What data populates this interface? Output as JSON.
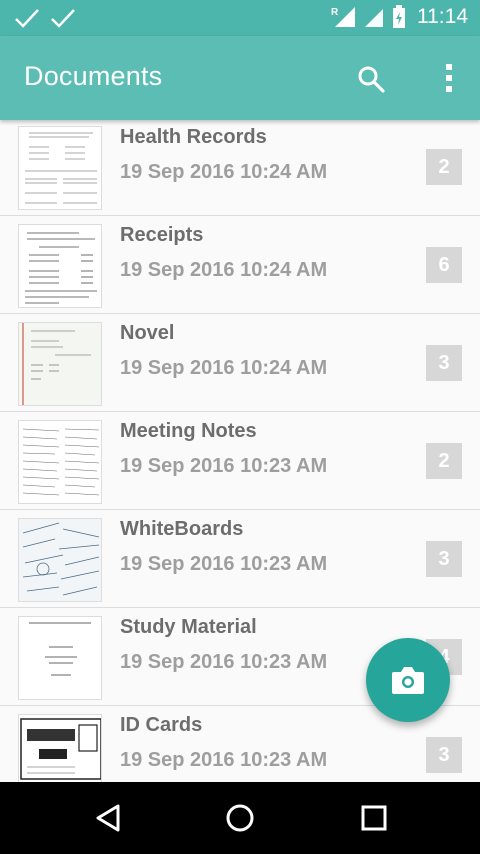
{
  "app": {
    "title": "Documents",
    "accent": "#5bbdb3",
    "fab_color": "#26a69a"
  },
  "status_bar": {
    "time": "11:14",
    "roaming_indicator": "R",
    "icons": [
      "check-icon",
      "check-icon",
      "signal-icon",
      "signal-icon",
      "battery-charging-icon"
    ]
  },
  "toolbar": {
    "search_icon": "search-icon",
    "more_icon": "more-vert-icon"
  },
  "documents": [
    {
      "title": "Health Records",
      "date": "19 Sep 2016 10:24 AM",
      "count": "2"
    },
    {
      "title": "Receipts",
      "date": "19 Sep 2016 10:24 AM",
      "count": "6"
    },
    {
      "title": "Novel",
      "date": "19 Sep 2016 10:24 AM",
      "count": "3"
    },
    {
      "title": "Meeting Notes",
      "date": "19 Sep 2016 10:23 AM",
      "count": "2"
    },
    {
      "title": "WhiteBoards",
      "date": "19 Sep 2016 10:23 AM",
      "count": "3"
    },
    {
      "title": "Study Material",
      "date": "19 Sep 2016 10:23 AM",
      "count": "4"
    },
    {
      "title": "ID Cards",
      "date": "19 Sep 2016 10:23 AM",
      "count": "3"
    }
  ],
  "fab": {
    "icon": "camera-icon"
  },
  "nav_bar": {
    "icons": [
      "back-icon",
      "home-icon",
      "recents-icon"
    ]
  }
}
